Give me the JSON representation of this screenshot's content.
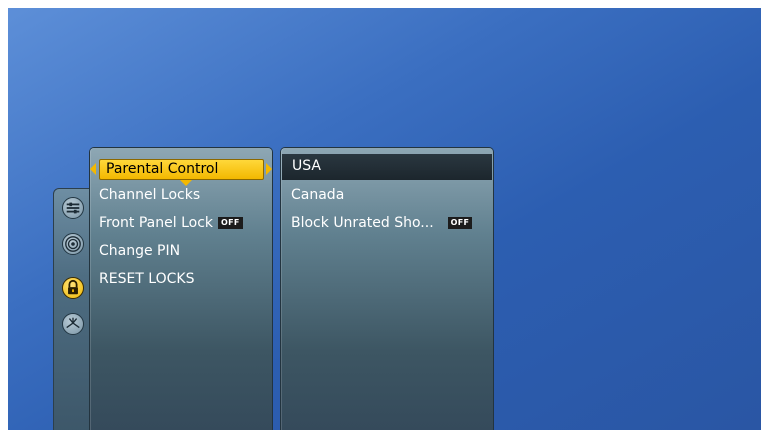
{
  "left_menu": {
    "selected": "Parental Control",
    "items": [
      {
        "label": "Channel Locks",
        "badge": ""
      },
      {
        "label": "Front Panel Lock",
        "badge": "OFF"
      },
      {
        "label": "Change PIN",
        "badge": ""
      },
      {
        "label": "RESET LOCKS",
        "badge": ""
      }
    ]
  },
  "right_menu": {
    "selected": "USA",
    "items": [
      {
        "label": "Canada",
        "badge": ""
      },
      {
        "label": "Block Unrated Sho...",
        "badge": "OFF"
      }
    ]
  },
  "rail_icons": [
    "settings-sliders-icon",
    "broadcast-signal-icon",
    "lock-icon",
    "satellite-dish-icon"
  ],
  "colors": {
    "highlight": "#f3b800",
    "background": "#2c5eb1",
    "badge_bg": "#1c1c1c"
  }
}
